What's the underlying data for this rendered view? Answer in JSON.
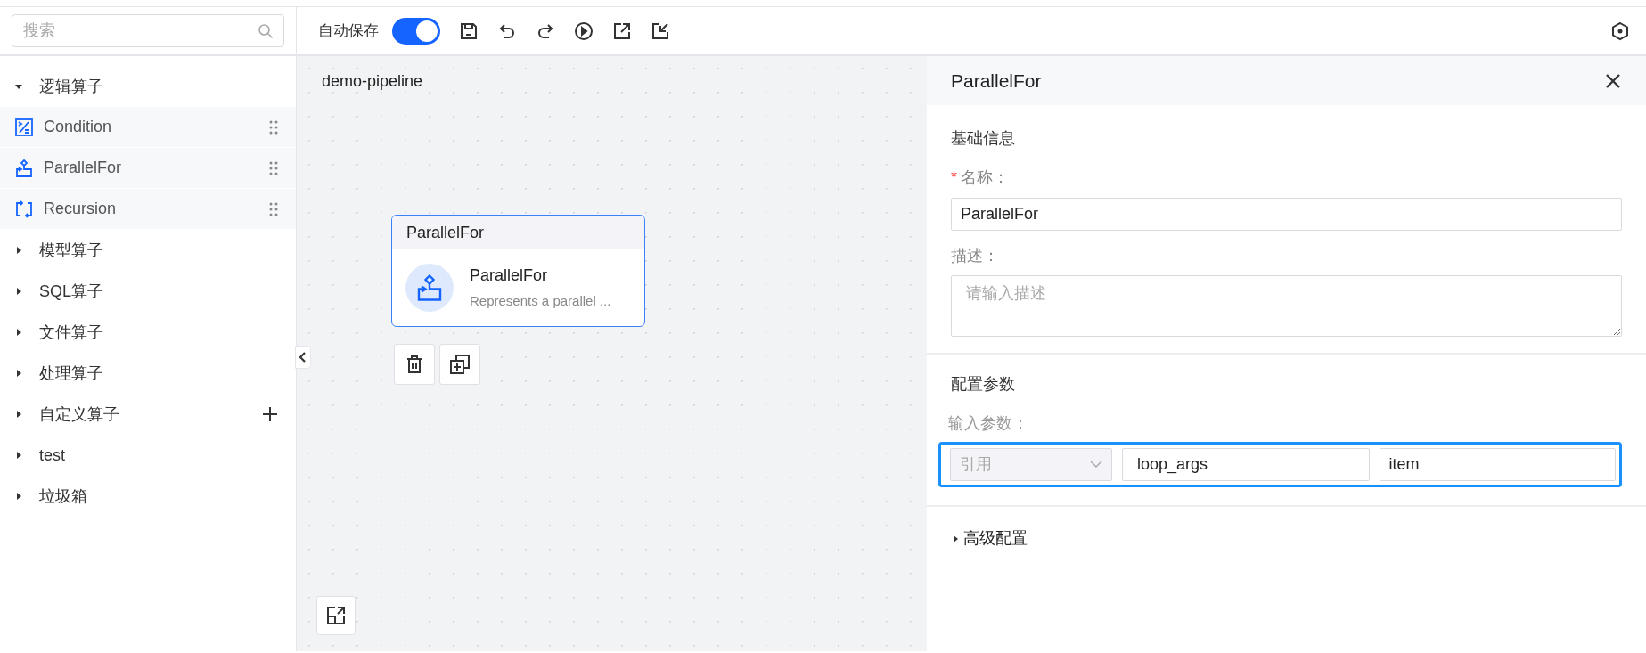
{
  "search": {
    "placeholder": "搜索"
  },
  "toolbar": {
    "autosave_label": "自动保存",
    "autosave_on": true
  },
  "sidebar": {
    "groups": [
      {
        "label": "逻辑算子",
        "expanded": true,
        "children": [
          {
            "label": "Condition",
            "kind": "condition"
          },
          {
            "label": "ParallelFor",
            "kind": "parallel"
          },
          {
            "label": "Recursion",
            "kind": "recursion"
          }
        ]
      },
      {
        "label": "模型算子",
        "expanded": false
      },
      {
        "label": "SQL算子",
        "expanded": false
      },
      {
        "label": "文件算子",
        "expanded": false
      },
      {
        "label": "处理算子",
        "expanded": false
      },
      {
        "label": "自定义算子",
        "expanded": false,
        "addable": true
      },
      {
        "label": "test",
        "expanded": false
      },
      {
        "label": "垃圾箱",
        "expanded": false
      }
    ]
  },
  "canvas": {
    "title": "demo-pipeline",
    "node": {
      "header": "ParallelFor",
      "name": "ParallelFor",
      "description": "Represents a parallel ...",
      "selected": true
    }
  },
  "panel": {
    "title": "ParallelFor",
    "basic_title": "基础信息",
    "name_field": {
      "label": "名称：",
      "required_mark": "*",
      "value": "ParallelFor"
    },
    "desc_field": {
      "label": "描述：",
      "placeholder": "请输入描述"
    },
    "config_title": "配置参数",
    "params_label": "输入参数：",
    "param": {
      "type": "引用",
      "type_disabled": true,
      "name": "loop_args",
      "value": "item",
      "focused": true
    },
    "advanced": {
      "label": "高级配置",
      "expanded": false
    }
  }
}
